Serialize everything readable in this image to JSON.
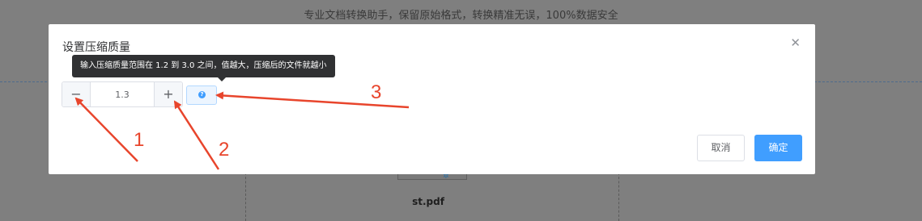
{
  "background": {
    "tagline": "专业文档转换助手，保留原始格式，转换精准无误，100%数据安全",
    "filename": "st.pdf"
  },
  "dialog": {
    "title": "设置压缩质量",
    "close_icon": "close-icon",
    "tooltip": "输入压缩质量范围在 1.2 到 3.0 之间，值越大，压缩后的文件就越小",
    "stepper": {
      "minus_label": "−",
      "plus_label": "+",
      "value": "1.3"
    },
    "help_icon": "question-circle-icon",
    "help_label": "?",
    "cancel_label": "取消",
    "ok_label": "确定"
  },
  "annotations": {
    "labels": [
      "1",
      "2",
      "3"
    ],
    "color": "#e8452c"
  },
  "colors": {
    "primary": "#409eff",
    "overlay": "#7f7f7f"
  }
}
